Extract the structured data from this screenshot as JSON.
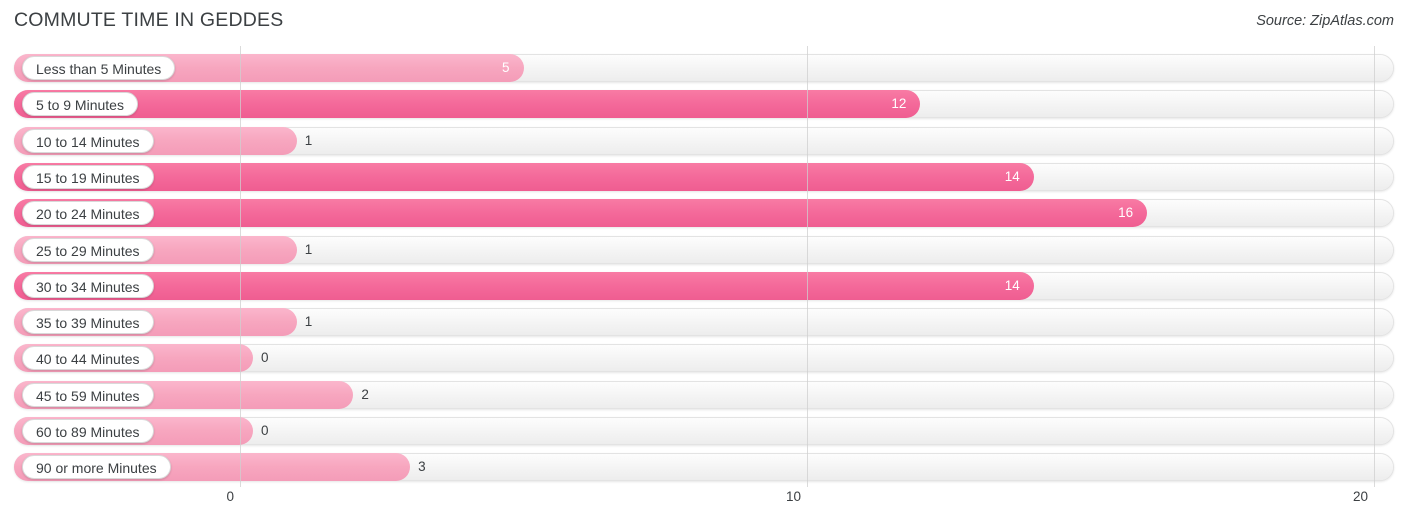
{
  "header": {
    "title": "COMMUTE TIME IN GEDDES",
    "source": "Source: ZipAtlas.com"
  },
  "colors": {
    "bar_dark": "#F4699A",
    "bar_light": "#F7A6BF",
    "track": "#F4F4F4",
    "gridline": "#CFCFCF",
    "text": "#3C4043"
  },
  "chart_data": {
    "type": "bar",
    "orientation": "horizontal",
    "title": "COMMUTE TIME IN GEDDES",
    "xlabel": "",
    "ylabel": "",
    "xlim": [
      0,
      20
    ],
    "xticks": [
      0,
      10,
      20
    ],
    "xtick_labels": [
      "0",
      "10",
      "20"
    ],
    "grid": true,
    "legend": false,
    "categories": [
      "Less than 5 Minutes",
      "5 to 9 Minutes",
      "10 to 14 Minutes",
      "15 to 19 Minutes",
      "20 to 24 Minutes",
      "25 to 29 Minutes",
      "30 to 34 Minutes",
      "35 to 39 Minutes",
      "40 to 44 Minutes",
      "45 to 59 Minutes",
      "60 to 89 Minutes",
      "90 or more Minutes"
    ],
    "values": [
      5,
      12,
      1,
      14,
      16,
      1,
      14,
      1,
      0,
      2,
      0,
      3
    ],
    "value_labels": [
      "5",
      "12",
      "1",
      "14",
      "16",
      "1",
      "14",
      "1",
      "0",
      "2",
      "0",
      "3"
    ]
  },
  "rows": [
    {
      "label": "Less than 5 Minutes",
      "value": 5,
      "value_label": "5",
      "shade": "light",
      "label_inside": true
    },
    {
      "label": "5 to 9 Minutes",
      "value": 12,
      "value_label": "12",
      "shade": "dark",
      "label_inside": true
    },
    {
      "label": "10 to 14 Minutes",
      "value": 1,
      "value_label": "1",
      "shade": "light",
      "label_inside": false
    },
    {
      "label": "15 to 19 Minutes",
      "value": 14,
      "value_label": "14",
      "shade": "dark",
      "label_inside": true
    },
    {
      "label": "20 to 24 Minutes",
      "value": 16,
      "value_label": "16",
      "shade": "dark",
      "label_inside": true
    },
    {
      "label": "25 to 29 Minutes",
      "value": 1,
      "value_label": "1",
      "shade": "light",
      "label_inside": false
    },
    {
      "label": "30 to 34 Minutes",
      "value": 14,
      "value_label": "14",
      "shade": "dark",
      "label_inside": true
    },
    {
      "label": "35 to 39 Minutes",
      "value": 1,
      "value_label": "1",
      "shade": "light",
      "label_inside": false
    },
    {
      "label": "40 to 44 Minutes",
      "value": 0,
      "value_label": "0",
      "shade": "light",
      "label_inside": false
    },
    {
      "label": "45 to 59 Minutes",
      "value": 2,
      "value_label": "2",
      "shade": "light",
      "label_inside": false
    },
    {
      "label": "60 to 89 Minutes",
      "value": 0,
      "value_label": "0",
      "shade": "light",
      "label_inside": false
    },
    {
      "label": "90 or more Minutes",
      "value": 3,
      "value_label": "3",
      "shade": "light",
      "label_inside": false
    }
  ],
  "axis": {
    "ticks": [
      {
        "label": "0",
        "value": 0
      },
      {
        "label": "10",
        "value": 10
      },
      {
        "label": "20",
        "value": 20
      }
    ]
  }
}
